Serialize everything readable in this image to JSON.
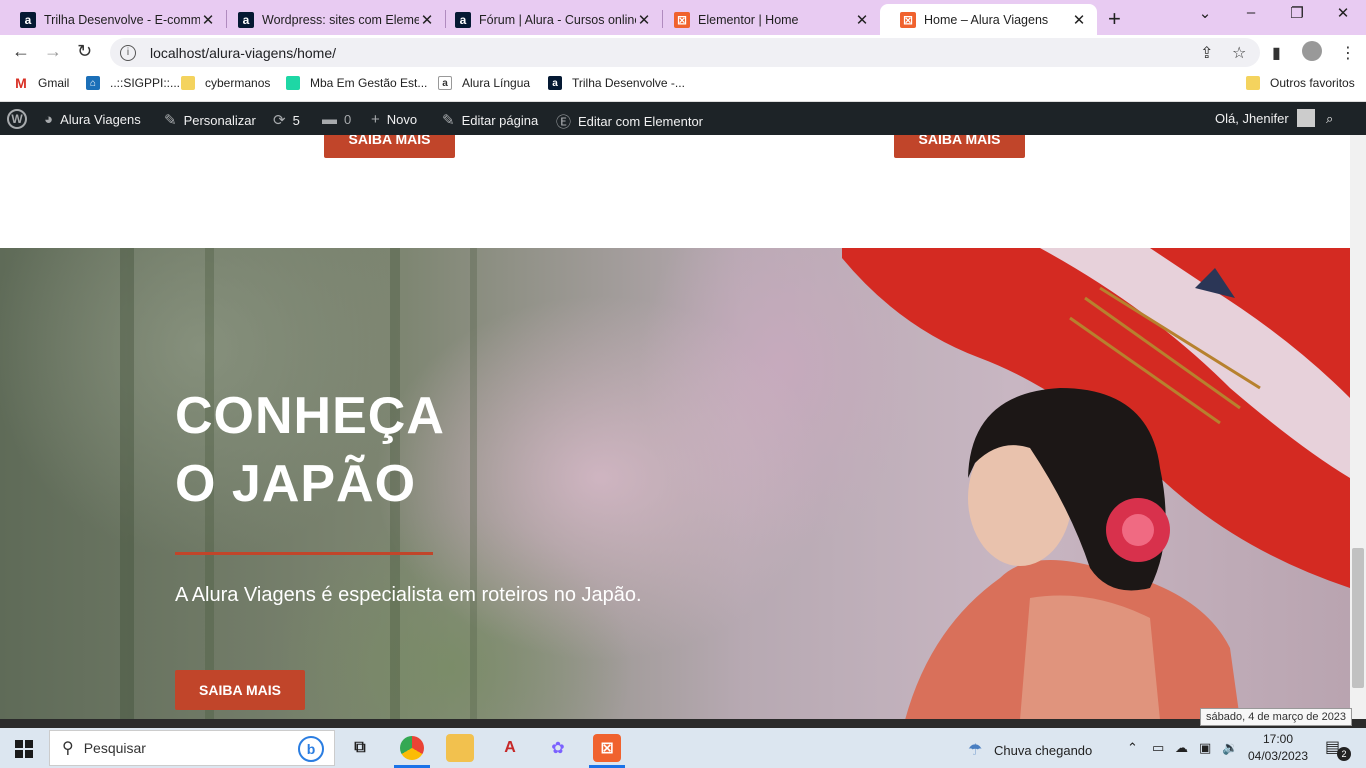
{
  "tabs": [
    {
      "title": "Trilha Desenvolve - E-comme",
      "favicon": "alura-icon"
    },
    {
      "title": "Wordpress: sites com Elemen",
      "favicon": "alura-icon"
    },
    {
      "title": "Fórum | Alura - Cursos online",
      "favicon": "alura-icon"
    },
    {
      "title": "Elementor | Home",
      "favicon": "elementor-icon"
    },
    {
      "title": "Home – Alura Viagens",
      "favicon": "elementor-icon",
      "active": true
    }
  ],
  "address": {
    "url": "localhost/alura-viagens/home/"
  },
  "bookmarks": {
    "items": [
      "Gmail",
      "..::SIGPPI::...",
      "cybermanos",
      "Mba Em Gestão Est...",
      "Alura Língua",
      "Trilha Desenvolve -..."
    ],
    "other": "Outros favoritos"
  },
  "adminbar": {
    "site": "Alura Viagens",
    "customize": "Personalizar",
    "updates": "5",
    "comments": "0",
    "new": "Novo",
    "edit": "Editar página",
    "elementor": "Editar com Elementor",
    "greeting": "Olá, Jhenifer"
  },
  "page": {
    "top_buttons": [
      "SAIBA MAIS",
      "SAIBA MAIS"
    ],
    "hero": {
      "title_line1": "CONHEÇA",
      "title_line2": "O JAPÃO",
      "subtitle": "A Alura Viagens é especialista em roteiros no Japão.",
      "button": "SAIBA MAIS"
    }
  },
  "taskbar": {
    "search_placeholder": "Pesquisar",
    "weather": "Chuva chegando",
    "time": "17:00",
    "date": "04/03/2023",
    "tooltip": "sábado, 4 de março de 2023",
    "notifications": "2"
  },
  "colors": {
    "accent": "#c1452a",
    "adminbar": "#1d2327",
    "tabstrip": "#e8cbf2"
  }
}
